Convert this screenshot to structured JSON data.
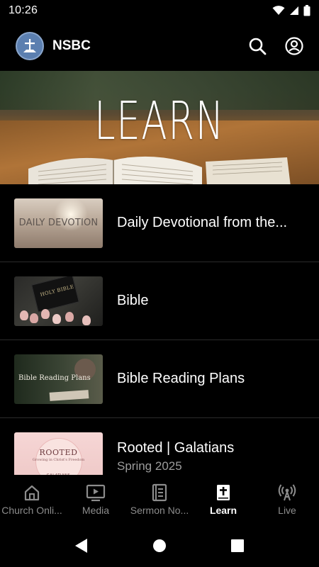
{
  "status_bar": {
    "time": "10:26"
  },
  "app_bar": {
    "title": "NSBC"
  },
  "hero": {
    "title": "LEARN"
  },
  "list": {
    "items": [
      {
        "title": "Daily Devotional from the...",
        "subtitle": "",
        "thumb_label": "DAILY DEVOTION"
      },
      {
        "title": "Bible",
        "subtitle": "",
        "thumb_label": "HOLY BIBLE"
      },
      {
        "title": "Bible Reading Plans",
        "subtitle": "",
        "thumb_label": "Bible Reading Plans"
      },
      {
        "title": "Rooted | Galatians",
        "subtitle": "Spring 2025",
        "thumb_label": "ROOTED",
        "thumb_sub": "Growing in Christ's Freedom",
        "thumb_tag": "GALATIANS"
      }
    ]
  },
  "bottom_nav": {
    "items": [
      {
        "label": "Church Onli...",
        "icon": "home-icon"
      },
      {
        "label": "Media",
        "icon": "play-icon"
      },
      {
        "label": "Sermon No...",
        "icon": "notes-icon"
      },
      {
        "label": "Learn",
        "icon": "bible-icon",
        "active": true
      },
      {
        "label": "Live",
        "icon": "broadcast-icon"
      }
    ]
  },
  "colors": {
    "background": "#000000",
    "text": "#ffffff",
    "muted": "#9c9c9c",
    "inactive_nav": "#8c8c8c"
  }
}
